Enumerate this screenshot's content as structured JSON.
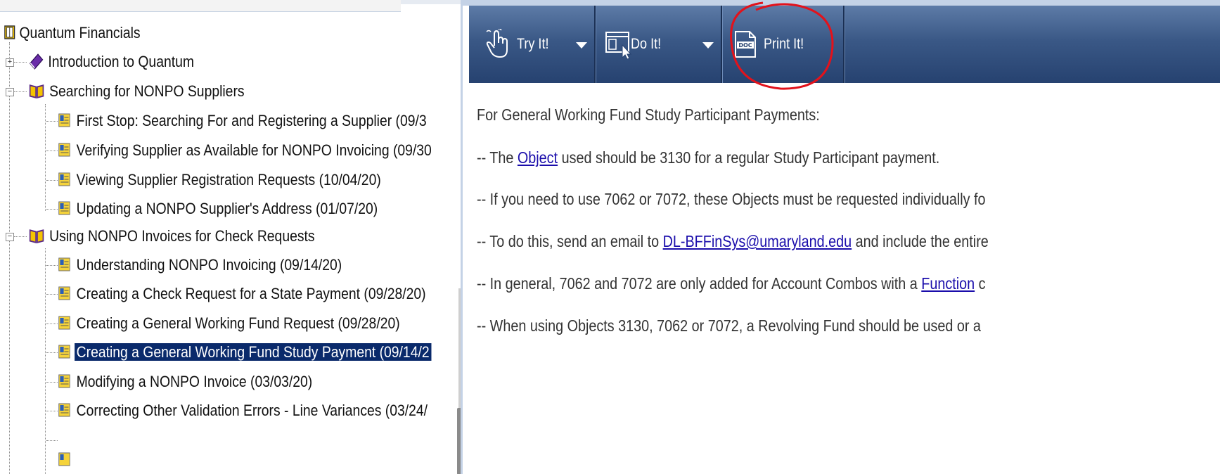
{
  "tree": {
    "root": "Quantum Financials",
    "nodes": [
      {
        "label": "Introduction to Quantum",
        "type": "folder-closed"
      },
      {
        "label": "Searching for NONPO Suppliers",
        "type": "folder-open"
      },
      {
        "label": "First Stop: Searching For and Registering a Supplier (09/3",
        "type": "topic"
      },
      {
        "label": "Verifying Supplier as Available for NONPO Invoicing (09/30",
        "type": "topic"
      },
      {
        "label": "Viewing Supplier Registration Requests (10/04/20)",
        "type": "topic"
      },
      {
        "label": "Updating a NONPO Supplier's Address (01/07/20)",
        "type": "topic"
      },
      {
        "label": "Using NONPO Invoices for Check Requests",
        "type": "folder-open"
      },
      {
        "label": "Understanding NONPO Invoicing (09/14/20)",
        "type": "topic"
      },
      {
        "label": "Creating a Check Request for a State Payment (09/28/20)",
        "type": "topic"
      },
      {
        "label": "Creating a General Working Fund Request (09/28/20)",
        "type": "topic"
      },
      {
        "label": "Creating a General Working Fund Study Payment (09/14/2",
        "type": "topic",
        "selected": true
      },
      {
        "label": "Modifying a NONPO Invoice (03/03/20)",
        "type": "topic"
      },
      {
        "label": "Correcting Other Validation Errors - Line Variances (03/24/",
        "type": "topic"
      }
    ]
  },
  "toolbar": {
    "try_label": "Try It!",
    "do_label": "Do It!",
    "print_label": "Print It!",
    "print_icon_text": "DOC"
  },
  "content": {
    "heading": "For General Working Fund Study Participant Payments:",
    "line1_pre": "-- The ",
    "line1_link": "Object",
    "line1_post": " used should be 3130 for a regular Study Participant payment.",
    "line2": "-- If you need to use 7062 or 7072, these Objects must be requested individually fo",
    "line3_pre": "-- To do this, send an email to ",
    "line3_link": "DL-BFFinSys@umaryland.edu",
    "line3_post": " and include the entire",
    "line4_pre": "-- In general, 7062 and 7072 are only added for Account Combos with a ",
    "line4_link": "Function",
    "line4_post": " c",
    "line5": "-- When using Objects 3130, 7062 or 7072, a Revolving Fund should be used or a"
  },
  "colors": {
    "toolbar": "#3a5886",
    "selected_bg": "#0a2a6b",
    "link": "#1a0dab",
    "annotation_circle": "#e3121b"
  }
}
